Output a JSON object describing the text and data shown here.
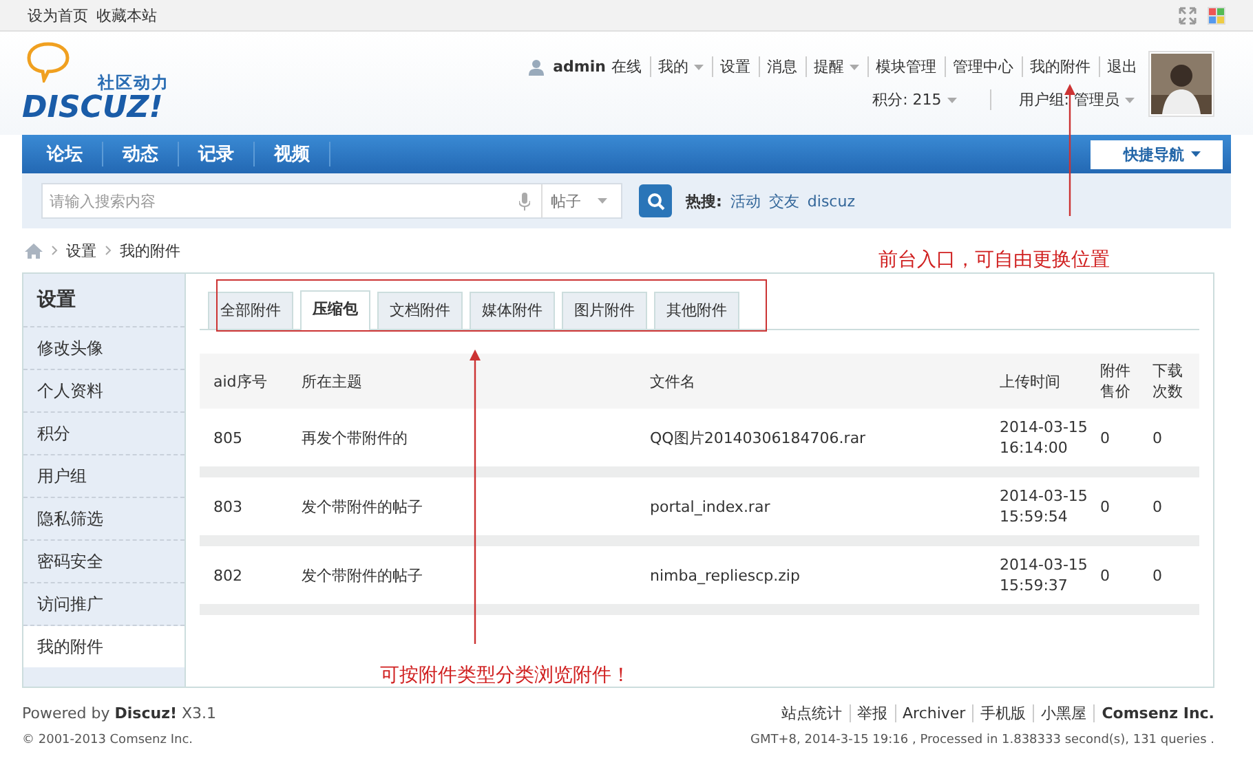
{
  "topbar": {
    "links": [
      "设为首页",
      "收藏本站"
    ]
  },
  "logo": {
    "tagline": "社区动力",
    "name": "DISCUZ!"
  },
  "user": {
    "name": "admin",
    "status": "在线",
    "links": [
      {
        "label": "我的",
        "dropdown": true
      },
      {
        "label": "设置",
        "dropdown": false
      },
      {
        "label": "消息",
        "dropdown": false
      },
      {
        "label": "提醒",
        "dropdown": true
      },
      {
        "label": "模块管理",
        "dropdown": false
      },
      {
        "label": "管理中心",
        "dropdown": false
      },
      {
        "label": "我的附件",
        "dropdown": false
      },
      {
        "label": "退出",
        "dropdown": false
      }
    ],
    "points": "积分: 215",
    "group": "用户组: 管理员"
  },
  "nav": {
    "items": [
      "论坛",
      "动态",
      "记录",
      "视频"
    ],
    "quick": "快捷导航"
  },
  "search": {
    "placeholder": "请输入搜索内容",
    "type": "帖子",
    "hot_label": "热搜:",
    "hot": [
      "活动",
      "交友",
      "discuz"
    ]
  },
  "breadcrumb": [
    "设置",
    "我的附件"
  ],
  "sidebar": {
    "title": "设置",
    "items": [
      {
        "label": "修改头像",
        "selected": false
      },
      {
        "label": "个人资料",
        "selected": false
      },
      {
        "label": "积分",
        "selected": false
      },
      {
        "label": "用户组",
        "selected": false
      },
      {
        "label": "隐私筛选",
        "selected": false
      },
      {
        "label": "密码安全",
        "selected": false
      },
      {
        "label": "访问推广",
        "selected": false
      },
      {
        "label": "我的附件",
        "selected": true
      }
    ]
  },
  "tabs": [
    {
      "label": "全部附件",
      "selected": false
    },
    {
      "label": "压缩包",
      "selected": true
    },
    {
      "label": "文档附件",
      "selected": false
    },
    {
      "label": "媒体附件",
      "selected": false
    },
    {
      "label": "图片附件",
      "selected": false
    },
    {
      "label": "其他附件",
      "selected": false
    }
  ],
  "table": {
    "columns": [
      "aid序号",
      "所在主题",
      "文件名",
      "上传时间",
      "附件售价",
      "下载次数"
    ],
    "rows": [
      [
        "805",
        "再发个带附件的",
        "QQ图片20140306184706.rar",
        "2014-03-15 16:14:00",
        "0",
        "0"
      ],
      [
        "803",
        "发个带附件的帖子",
        "portal_index.rar",
        "2014-03-15 15:59:54",
        "0",
        "0"
      ],
      [
        "802",
        "发个带附件的帖子",
        "nimba_repliescp.zip",
        "2014-03-15 15:59:37",
        "0",
        "0"
      ]
    ]
  },
  "annotations": [
    "前台入口，可自由更换位置",
    "可按附件类型分类浏览附件！"
  ],
  "footer": {
    "powered_prefix": "Powered by",
    "powered_brand": "Discuz!",
    "version": "X3.1",
    "links": [
      "站点统计",
      "举报",
      "Archiver",
      "手机版",
      "小黑屋",
      "Comsenz Inc."
    ],
    "copyright": "© 2001-2013 Comsenz Inc.",
    "stats": "GMT+8, 2014-3-15 19:16 , Processed in 1.838333 second(s), 131 queries ."
  }
}
